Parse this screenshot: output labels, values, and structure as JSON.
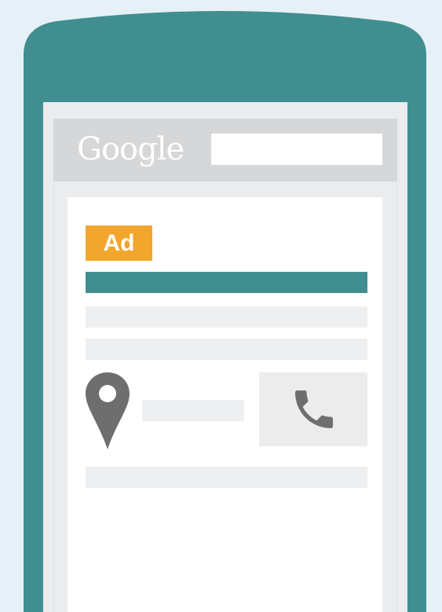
{
  "header": {
    "logo_text": "Google",
    "search": {
      "value": "",
      "placeholder": ""
    }
  },
  "ad": {
    "badge_label": "Ad"
  },
  "icons": {
    "location": "map-pin-icon",
    "call": "phone-icon"
  },
  "colors": {
    "page_background": "#e6f1f7",
    "phone_body": "#418e91",
    "ad_badge": "#f2a62d",
    "headline_bar": "#418e91",
    "placeholder_lines": "#eeeff0",
    "icon_gray": "#6e6e6e"
  }
}
